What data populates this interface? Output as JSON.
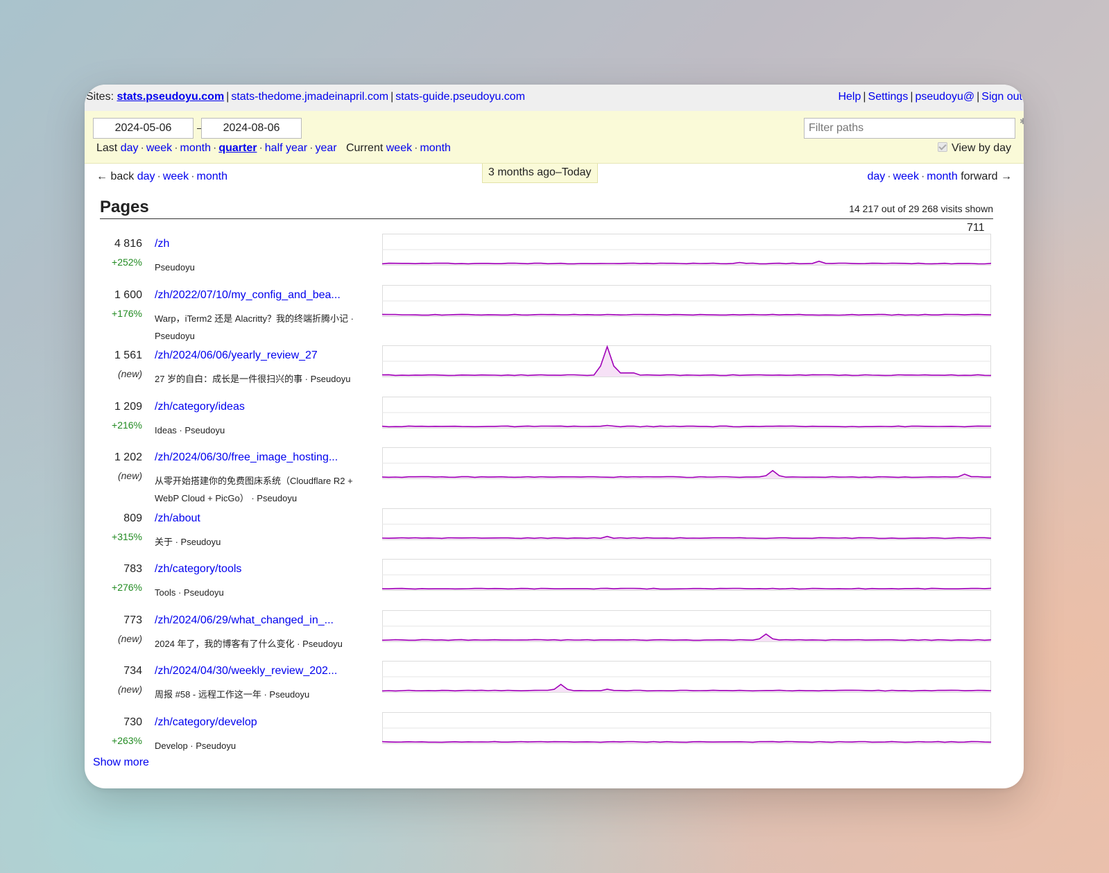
{
  "sites": {
    "label": "Sites:",
    "items": [
      "stats.pseudoyu.com",
      "stats-thedome.jmadeinapril.com",
      "stats-guide.pseudoyu.com"
    ]
  },
  "account": {
    "help": "Help",
    "settings": "Settings",
    "user": "pseudoyu@",
    "signout": "Sign out"
  },
  "filters": {
    "date_from": "2024-05-06",
    "date_to": "2024-08-06",
    "filter_placeholder": "Filter paths",
    "last_label": "Last",
    "last_periods": [
      "day",
      "week",
      "month",
      "quarter",
      "half year",
      "year"
    ],
    "current_label": "Current",
    "current_periods": [
      "week",
      "month"
    ],
    "view_by_day": "View by day",
    "view_by_day_checked": true
  },
  "nav": {
    "back_label": "← back",
    "back_links": [
      "day",
      "week",
      "month"
    ],
    "period": "3 months ago–Today",
    "forward_links": [
      "day",
      "week",
      "month"
    ],
    "forward_label": "forward →"
  },
  "pages": {
    "title": "Pages",
    "summary": "14 217 out of 29 268 visits shown",
    "scale_max": "711",
    "show_more": "Show more",
    "line_color": "#a000b8",
    "fill_color": "#f6e1f6",
    "rows": [
      {
        "count": "4 816",
        "change": "+252%",
        "path": "/zh",
        "title": "Pseudoyu",
        "spikes": [
          [
            54,
            0.08
          ],
          [
            66,
            0.12
          ]
        ]
      },
      {
        "count": "1 600",
        "change": "+176%",
        "path": "/zh/2022/07/10/my_config_and_bea...",
        "title": "Warp，iTerm2 还是 Alacritty？我的终端折腾小记 · Pseudoyu",
        "spikes": []
      },
      {
        "count": "1 561",
        "change": "(new)",
        "path": "/zh/2024/06/06/yearly_review_27",
        "title": "27 岁的自白：成长是一件很扫兴的事 · Pseudoyu",
        "spikes": [
          [
            34,
            0.98
          ]
        ]
      },
      {
        "count": "1 209",
        "change": "+216%",
        "path": "/zh/category/ideas",
        "title": "Ideas · Pseudoyu",
        "spikes": [
          [
            34,
            0.08
          ]
        ]
      },
      {
        "count": "1 202",
        "change": "(new)",
        "path": "/zh/2024/06/30/free_image_hosting...",
        "title": "从零开始搭建你的免费图床系统（Cloudflare R2 + WebP Cloud + PicGo） · Pseudoyu",
        "spikes": [
          [
            59,
            0.26
          ],
          [
            88,
            0.14
          ]
        ]
      },
      {
        "count": "809",
        "change": "+315%",
        "path": "/zh/about",
        "title": "关于 · Pseudoyu",
        "spikes": [
          [
            34,
            0.1
          ]
        ]
      },
      {
        "count": "783",
        "change": "+276%",
        "path": "/zh/category/tools",
        "title": "Tools · Pseudoyu",
        "spikes": [
          [
            34,
            0.06
          ]
        ]
      },
      {
        "count": "773",
        "change": "(new)",
        "path": "/zh/2024/06/29/what_changed_in_...",
        "title": "2024 年了，我的博客有了什么变化 · Pseudoyu",
        "spikes": [
          [
            58,
            0.24
          ]
        ]
      },
      {
        "count": "734",
        "change": "(new)",
        "path": "/zh/2024/04/30/weekly_review_202...",
        "title": "周报 #58 - 远程工作这一年 · Pseudoyu",
        "spikes": [
          [
            27,
            0.25
          ],
          [
            34,
            0.09
          ]
        ]
      },
      {
        "count": "730",
        "change": "+263%",
        "path": "/zh/category/develop",
        "title": "Develop · Pseudoyu",
        "spikes": [
          [
            34,
            0.05
          ]
        ]
      }
    ]
  }
}
